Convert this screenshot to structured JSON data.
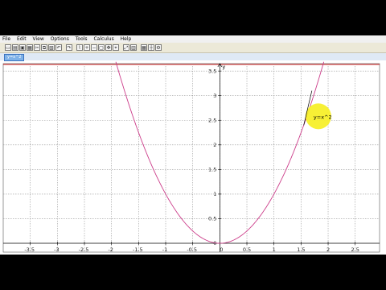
{
  "menu": [
    "File",
    "Edit",
    "View",
    "Options",
    "Tools",
    "Calculus",
    "Help"
  ],
  "toolbar_icons": [
    "new-icon",
    "open-icon",
    "save-icon",
    "print-icon",
    "cut-icon",
    "copy-icon",
    "paste-icon",
    "undo-icon",
    "redo-icon",
    "graph-icon",
    "zoom-in-icon",
    "zoom-out-icon",
    "zoom-box-icon",
    "pan-icon",
    "trace-icon",
    "fit-icon",
    "table-icon",
    "grid-icon",
    "axes-icon",
    "settings-icon"
  ],
  "tab": {
    "label": "y=x^2"
  },
  "chart_data": {
    "type": "line",
    "series": [
      {
        "name": "y=x^2",
        "function": "x^2",
        "x_range": [
          -2,
          2
        ],
        "color": "#cc3d8a"
      }
    ],
    "xlim": [
      -4.0,
      2.95
    ],
    "ylim": [
      -0.18,
      3.65
    ],
    "xticks": [
      -3.5,
      -3,
      -2.5,
      -2,
      -1.5,
      -1,
      -0.5,
      0,
      0.5,
      1,
      1.5,
      2,
      2.5
    ],
    "yticks": [
      0,
      0.5,
      1,
      1.5,
      2,
      2.5,
      3,
      3.5
    ],
    "ylabel": "y",
    "grid": true,
    "annotation": {
      "text": "y=x^2"
    }
  }
}
